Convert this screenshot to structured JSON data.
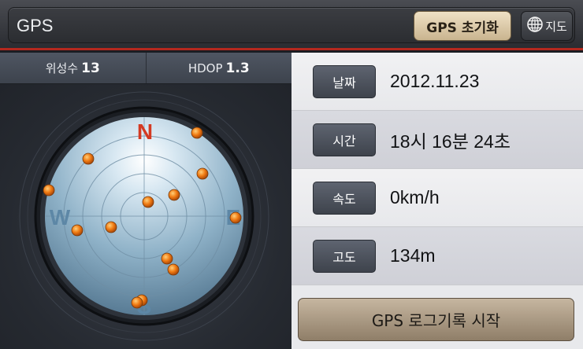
{
  "header": {
    "title": "GPS",
    "reset_label": "GPS 초기화",
    "map_label": "지도"
  },
  "stats": {
    "sat_label": "위성수",
    "sat_count": "13",
    "hdop_label": "HDOP",
    "hdop_value": "1.3"
  },
  "compass": {
    "n": "N",
    "e": "E",
    "s": "S",
    "w": "W"
  },
  "info": {
    "date_label": "날짜",
    "date_value": "2012.11.23",
    "time_label": "시간",
    "time_value": "18시 16분 24초",
    "speed_label": "속도",
    "speed_value": "0km/h",
    "alt_label": "고도",
    "alt_value": "134m"
  },
  "log_button": "GPS 로그기록 시작",
  "colors": {
    "accent_red": "#b4281e",
    "north_red": "#d43a22",
    "satellite_orange": "#f07a12"
  }
}
